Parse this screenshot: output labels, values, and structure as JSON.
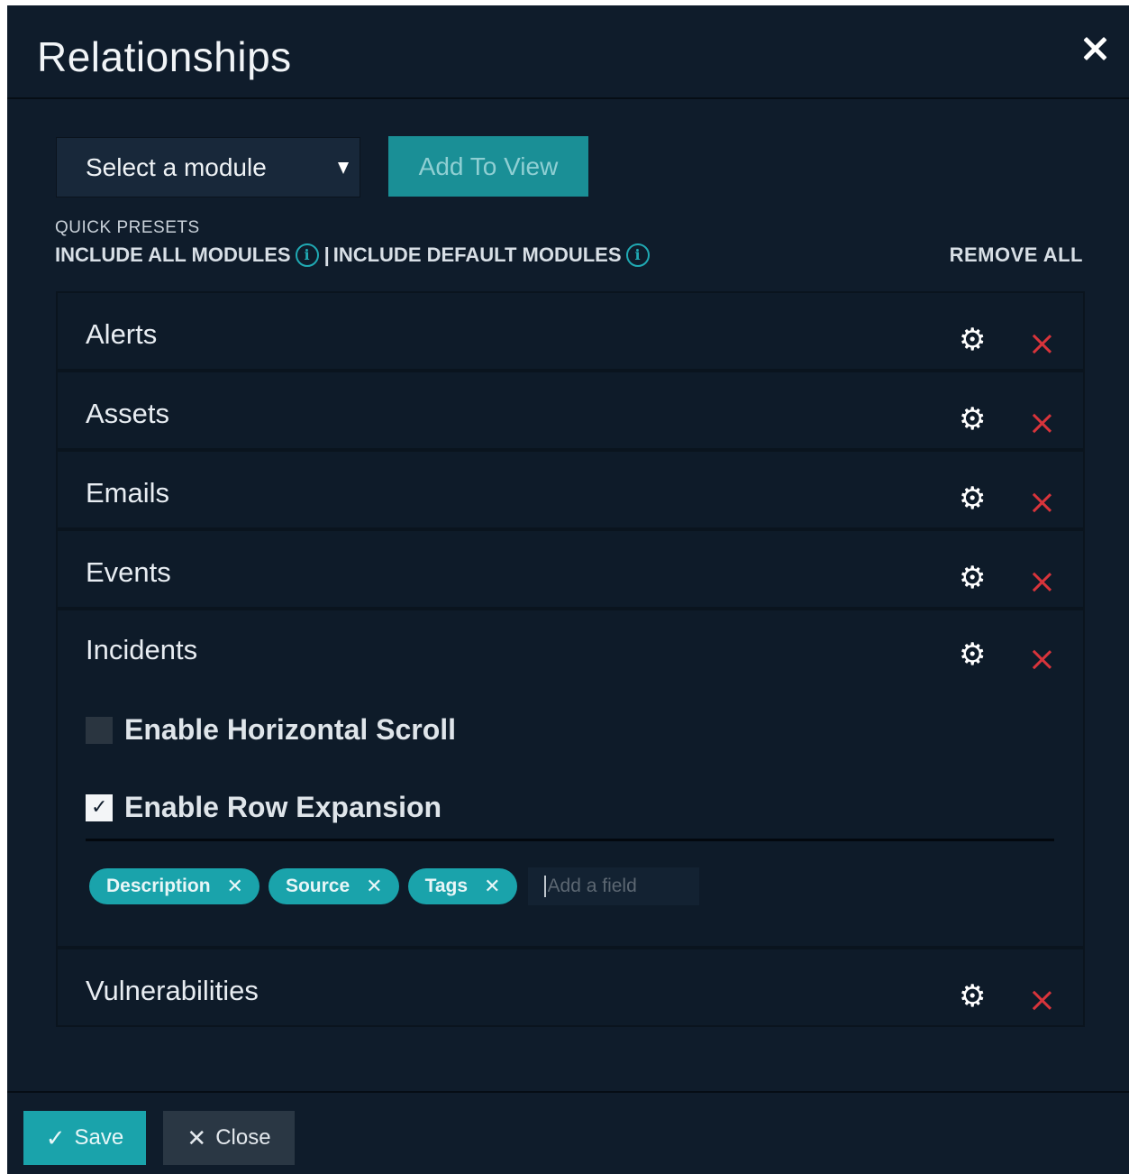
{
  "dialog": {
    "title": "Relationships",
    "close_icon": "close-icon"
  },
  "toolbar": {
    "select_placeholder": "Select a module",
    "add_button": "Add To View"
  },
  "presets": {
    "label": "QUICK PRESETS",
    "include_all": "INCLUDE ALL MODULES",
    "separator": "|",
    "include_default": "INCLUDE DEFAULT MODULES",
    "remove_all": "REMOVE ALL",
    "info_glyph": "i"
  },
  "modules": {
    "items": [
      {
        "name": "Alerts"
      },
      {
        "name": "Assets"
      },
      {
        "name": "Emails"
      },
      {
        "name": "Events"
      },
      {
        "name": "Incidents"
      },
      {
        "name": "Vulnerabilities"
      }
    ],
    "incidents_options": {
      "horizontal_scroll_label": "Enable Horizontal Scroll",
      "horizontal_scroll_checked": false,
      "row_expansion_label": "Enable Row Expansion",
      "row_expansion_checked": true,
      "fields": [
        "Description",
        "Source",
        "Tags"
      ],
      "field_input_placeholder": "Add a field"
    }
  },
  "footer": {
    "save_label": "Save",
    "close_label": "Close"
  },
  "colors": {
    "background": "#0f1c2b",
    "accent": "#1aa3ab",
    "delete": "#d8343b"
  }
}
